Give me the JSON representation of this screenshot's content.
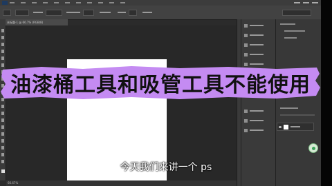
{
  "app": {
    "document_tab": "未标题-1 @ 66.7% (RGB/8)",
    "status_zoom": "66.67%"
  },
  "overlay": {
    "banner_title": "油漆桶工具和吸管工具不能使用",
    "banner_color": "#c48bf2",
    "subtitle": "今天我们来讲一个 ps"
  },
  "colors": {
    "workspace": "#282828",
    "panel": "#3a3a3a",
    "canvas": "#ffffff"
  }
}
